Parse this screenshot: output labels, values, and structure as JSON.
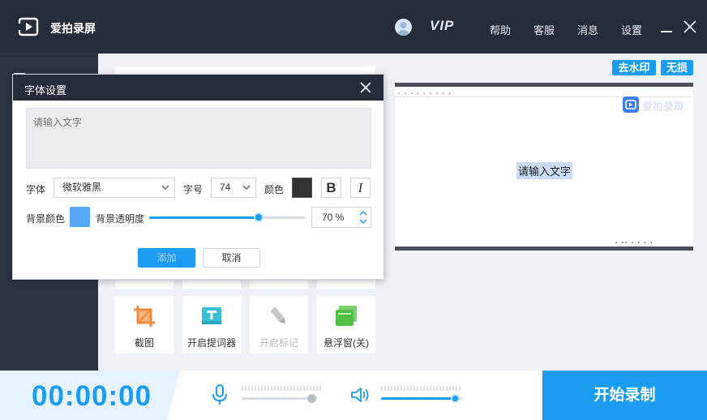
{
  "app": {
    "title": "爱拍录屏",
    "vip_label": "VIP"
  },
  "header": {
    "links": [
      "帮助",
      "客服",
      "消息",
      "设置"
    ]
  },
  "preview": {
    "tags": [
      "去水印",
      "无损"
    ],
    "overlay_text": "请输入文字",
    "watermark_text": "爱拍录屏"
  },
  "tools": [
    {
      "label": "截图",
      "icon": "crop-icon",
      "enabled": true
    },
    {
      "label": "开启提词器",
      "icon": "teleprompter-icon",
      "enabled": true
    },
    {
      "label": "开启标记",
      "icon": "marker-icon",
      "enabled": false
    },
    {
      "label": "悬浮窗(关)",
      "icon": "floating-window-icon",
      "enabled": true
    }
  ],
  "bottom": {
    "timer": "00:00:00",
    "record_label": "开始录制",
    "mic_level": 0.92,
    "speaker_level": 0.93
  },
  "dialog": {
    "title": "字体设置",
    "text_placeholder": "请输入文字",
    "font_label": "字体",
    "font_value": "微软雅黑",
    "size_label": "字号",
    "size_value": "74",
    "color_label": "颜色",
    "text_color": "#333333",
    "bold_label": "B",
    "italic_label": "I",
    "bg_color_label": "背景颜色",
    "bg_color": "#56a8f5",
    "opacity_label": "背景透明度",
    "opacity_value": "70 %",
    "opacity_fraction": 0.7,
    "add_label": "添加",
    "cancel_label": "取消"
  },
  "colors": {
    "accent": "#1a9cf0",
    "titlebar": "#262c3a",
    "sidebar": "#2c3341"
  }
}
